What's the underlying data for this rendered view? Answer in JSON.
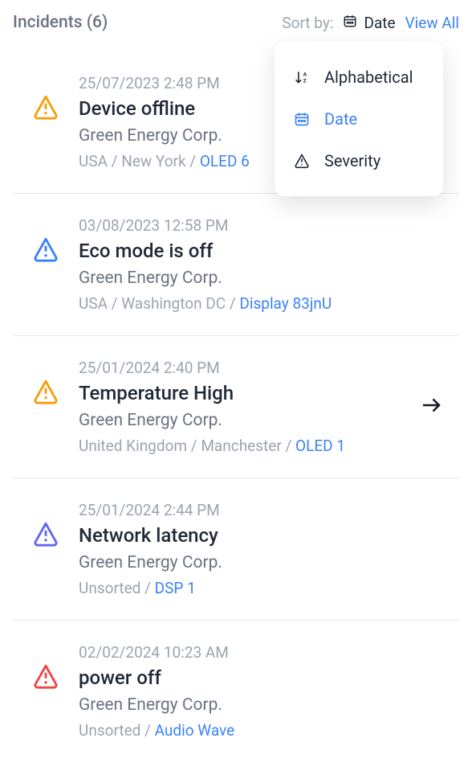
{
  "header": {
    "title": "Incidents (6)",
    "sortByLabel": "Sort by:",
    "sortValue": "Date",
    "viewAll": "View All"
  },
  "dropdown": {
    "items": [
      {
        "label": "Alphabetical",
        "icon": "sort-az",
        "active": false
      },
      {
        "label": "Date",
        "icon": "calendar",
        "active": true
      },
      {
        "label": "Severity",
        "icon": "warning",
        "active": false
      }
    ]
  },
  "incidents": [
    {
      "timestamp": "25/07/2023 2:48 PM",
      "title": "Device offline",
      "company": "Green Energy Corp.",
      "locationPrefix": "USA / New York / ",
      "device": "OLED 6",
      "severity": "warning",
      "hasArrow": false
    },
    {
      "timestamp": "03/08/2023 12:58 PM",
      "title": "Eco mode is off",
      "company": "Green Energy Corp.",
      "locationPrefix": "USA / Washington DC / ",
      "device": "Display 83jnU",
      "severity": "info",
      "hasArrow": false
    },
    {
      "timestamp": "25/01/2024 2:40 PM",
      "title": "Temperature High",
      "company": "Green Energy Corp.",
      "locationPrefix": "United Kingdom / Manchester / ",
      "device": "OLED 1",
      "severity": "warning",
      "hasArrow": true
    },
    {
      "timestamp": "25/01/2024 2:44 PM",
      "title": "Network latency",
      "company": "Green Energy Corp.",
      "locationPrefix": "Unsorted / ",
      "device": "DSP 1",
      "severity": "purple",
      "hasArrow": false
    },
    {
      "timestamp": "02/02/2024 10:23 AM",
      "title": "power off",
      "company": "Green Energy Corp.",
      "locationPrefix": "Unsorted / ",
      "device": "Audio Wave",
      "severity": "critical",
      "hasArrow": false
    }
  ],
  "colors": {
    "warning": "#f59e0b",
    "info": "#3b82f6",
    "purple": "#6366f1",
    "critical": "#ef4444"
  }
}
